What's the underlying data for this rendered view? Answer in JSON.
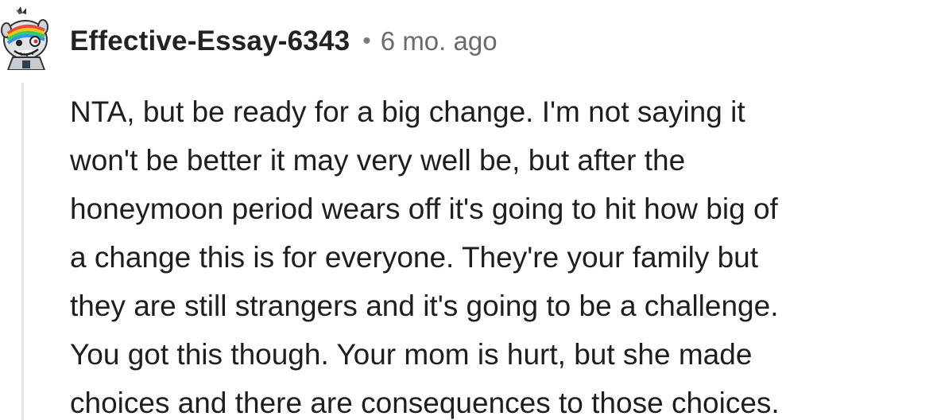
{
  "comment": {
    "author": "Effective-Essay-6343",
    "separator": "•",
    "age": "6 mo. ago",
    "avatar_icon": "snoo-avatar-icon",
    "body_lines": [
      "NTA, but be ready for a big change. I'm not saying it",
      "won't be better it may very well be, but after the",
      "honeymoon period wears off it's going to hit how big of",
      "a change this is for everyone. They're your family but",
      "they are still strangers and it's going to be a challenge.",
      "You got this though. Your mom is hurt, but she made",
      "choices and there are consequences to those choices."
    ]
  },
  "colors": {
    "thread_line": "#e5e5e5",
    "text": "#1e1e1e",
    "meta_text": "#6b6b6b"
  }
}
